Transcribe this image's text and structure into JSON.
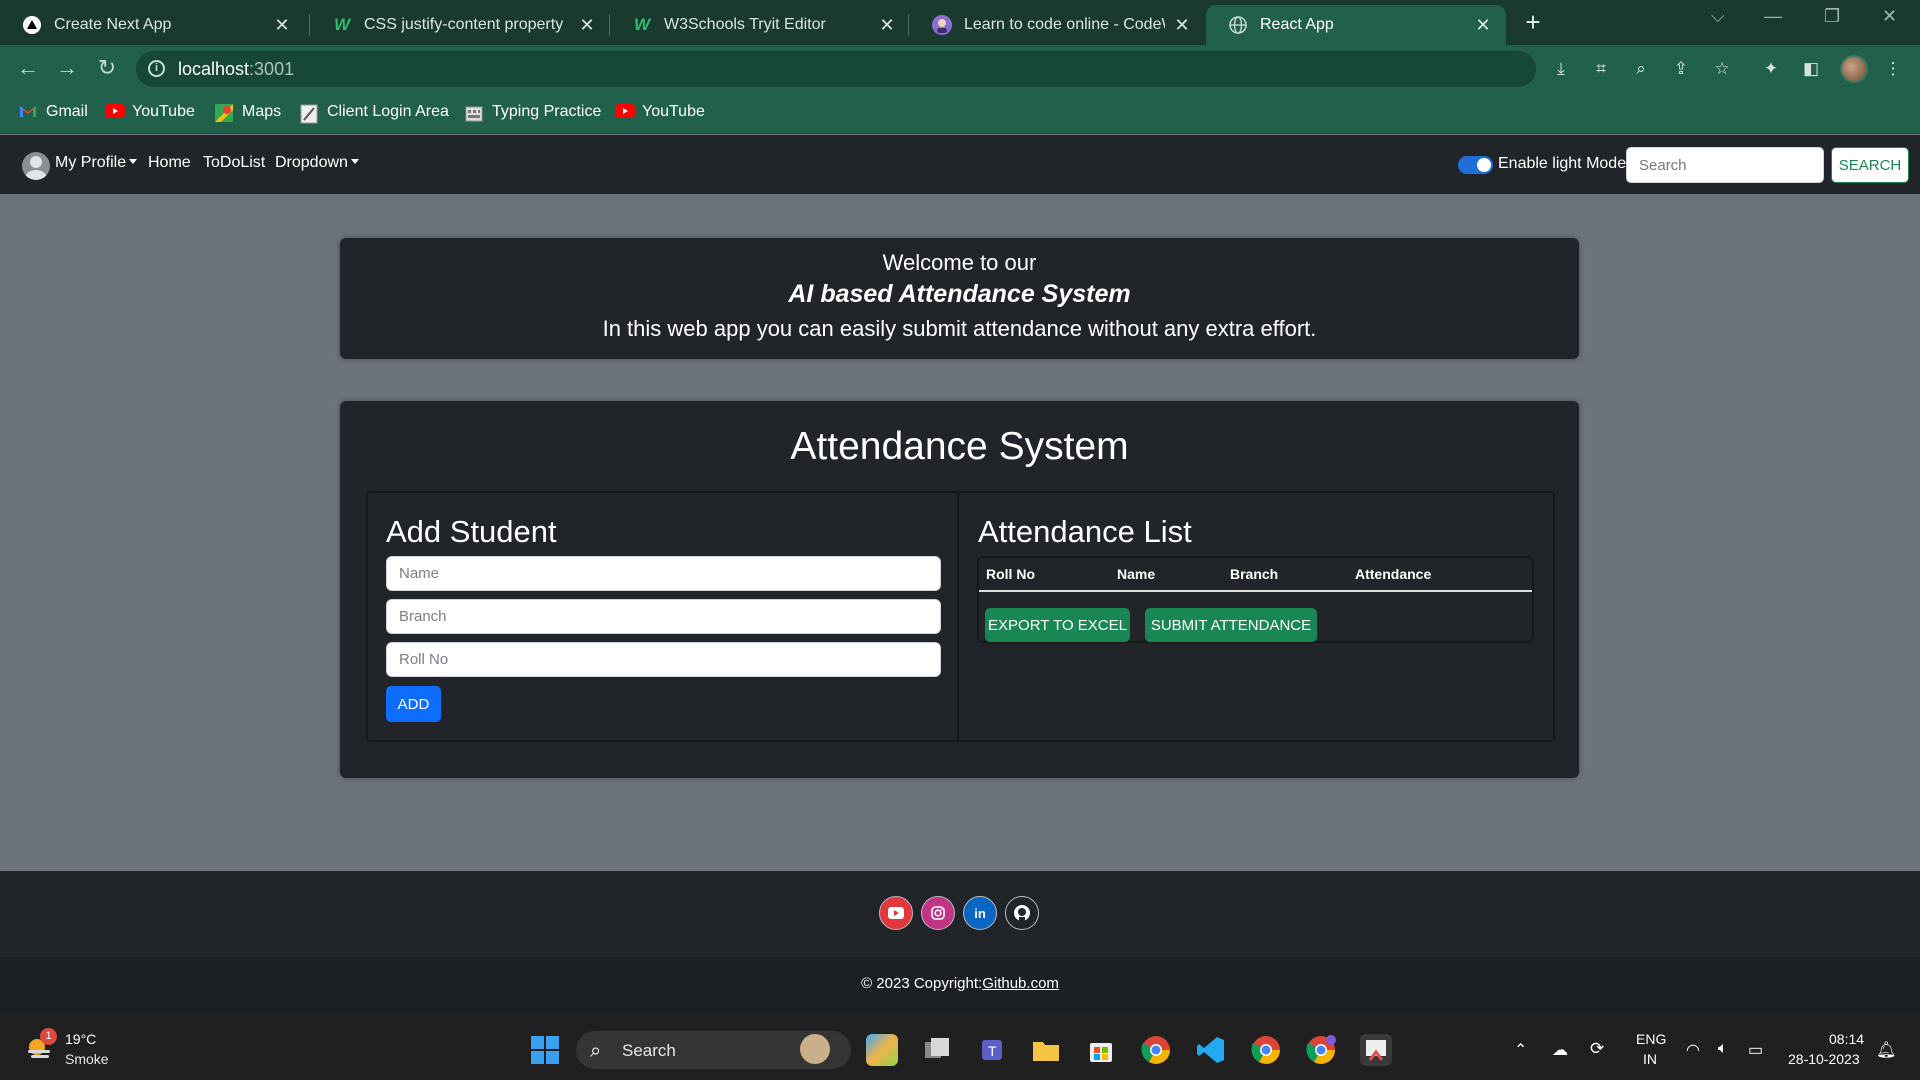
{
  "browser": {
    "tabs": [
      {
        "title": "Create Next App",
        "icon": "nextjs-icon"
      },
      {
        "title": "CSS justify-content property",
        "icon": "w3schools-icon"
      },
      {
        "title": "W3Schools Tryit Editor",
        "icon": "w3schools-icon"
      },
      {
        "title": "Learn to code online - CodeWith",
        "icon": "codewithharry-icon"
      },
      {
        "title": "React App",
        "icon": "globe-icon",
        "active": true
      }
    ],
    "url_host": "localhost",
    "url_port": ":3001",
    "bookmarks": [
      {
        "label": "Gmail",
        "icon": "gmail-icon"
      },
      {
        "label": "YouTube",
        "icon": "youtube-icon"
      },
      {
        "label": "Maps",
        "icon": "maps-icon"
      },
      {
        "label": "Client Login Area",
        "icon": "document-icon"
      },
      {
        "label": "Typing Practice",
        "icon": "keyboard-icon"
      },
      {
        "label": "YouTube",
        "icon": "youtube-icon"
      }
    ]
  },
  "app_nav": {
    "profile": "My Profile",
    "home": "Home",
    "todolist": "ToDoList",
    "dropdown": "Dropdown",
    "toggle_label": "Enable light Mode",
    "search_placeholder": "Search",
    "search_button": "SEARCH"
  },
  "welcome": {
    "line1": "Welcome to our",
    "line2": "AI based Attendance System",
    "line3": "In this web app you can easily submit attendance without any extra effort."
  },
  "attendance": {
    "title": "Attendance System",
    "add_student": {
      "heading": "Add Student",
      "name_placeholder": "Name",
      "branch_placeholder": "Branch",
      "roll_placeholder": "Roll No",
      "add_button": "ADD"
    },
    "list": {
      "heading": "Attendance List",
      "columns": [
        "Roll No",
        "Name",
        "Branch",
        "Attendance"
      ],
      "export_button": "EXPORT TO EXCEL",
      "submit_button": "SUBMIT ATTENDANCE"
    }
  },
  "footer": {
    "social": [
      {
        "name": "youtube",
        "color": "#e0383e"
      },
      {
        "name": "instagram",
        "color": "#c13584"
      },
      {
        "name": "linkedin",
        "color": "#0a66c2"
      },
      {
        "name": "github",
        "color": "#212529"
      }
    ],
    "copyright_prefix": "© 2023 Copyright:",
    "copyright_link": "Github.com"
  },
  "taskbar": {
    "weather_badge": "1",
    "temperature": "19°C",
    "condition": "Smoke",
    "search_label": "Search",
    "language": "ENG",
    "region": "IN",
    "time": "08:14",
    "date": "28-10-2023"
  },
  "colors": {
    "chrome_dark": "#1a3a30",
    "chrome": "#21604a",
    "navbar": "#212529",
    "page_bg": "#6c737d",
    "primary": "#0d6efd",
    "success": "#198754"
  }
}
